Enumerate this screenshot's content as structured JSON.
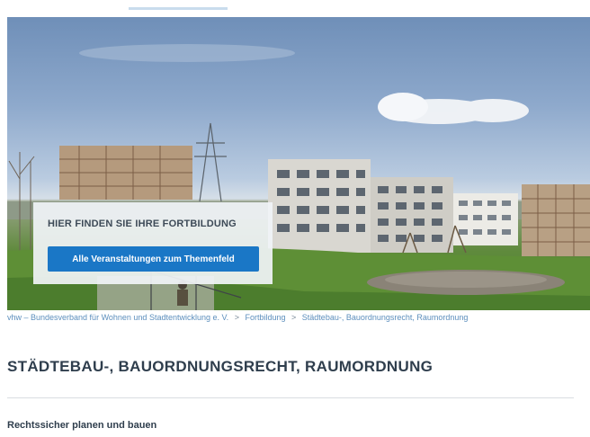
{
  "hero": {
    "card_title": "HIER FINDEN SIE IHRE FORTBILDUNG",
    "cta_label": "Alle Veranstaltungen zum Themenfeld"
  },
  "breadcrumb": {
    "items": [
      "vhw – Bundesverband für Wohnen und Stadtentwicklung e. V.",
      "Fortbildung",
      "Städtebau-, Bauordnungsrecht, Raumordnung"
    ],
    "separator": ">"
  },
  "main": {
    "title": "STÄDTEBAU-, BAUORDNUNGSRECHT, RAUMORDNUNG",
    "subtitle": "Rechtssicher planen und bauen"
  },
  "colors": {
    "accent": "#1a77c6",
    "link": "#5d8fbd",
    "heading": "#2f3e4d"
  }
}
